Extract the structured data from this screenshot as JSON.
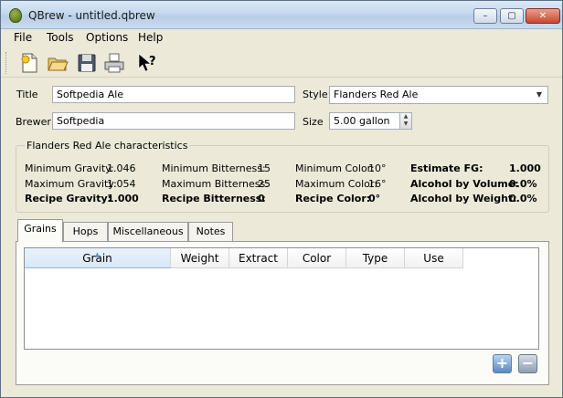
{
  "window": {
    "title": "QBrew - untitled.qbrew",
    "controls": {
      "minimize": "–",
      "maximize": "▢",
      "close": "✕"
    }
  },
  "menu": [
    "File",
    "Tools",
    "Options",
    "Help"
  ],
  "toolbar": {
    "buttons": [
      "new-document-icon",
      "open-folder-icon",
      "save-disk-icon",
      "print-icon",
      "whats-this-help-icon"
    ]
  },
  "form": {
    "title_label": "Title",
    "title_value": "Softpedia Ale",
    "style_label": "Style",
    "style_value": "Flanders Red Ale",
    "brewer_label": "Brewer",
    "brewer_value": "Softpedia",
    "size_label": "Size",
    "size_value": "5.00 gallon"
  },
  "characteristics": {
    "group_title": "Flanders Red Ale characteristics",
    "min_gravity_label": "Minimum Gravity:",
    "min_gravity": "1.046",
    "max_gravity_label": "Maximum Gravity:",
    "max_gravity": "1.054",
    "recipe_gravity_label": "Recipe Gravity:",
    "recipe_gravity": "1.000",
    "min_bitterness_label": "Minimum Bitterness:",
    "min_bitterness": "15",
    "max_bitterness_label": "Maximum Bitterness:",
    "max_bitterness": "25",
    "recipe_bitterness_label": "Recipe Bitterness:",
    "recipe_bitterness": "0",
    "min_color_label": "Minimum Color:",
    "min_color": "10°",
    "max_color_label": "Maximum Color:",
    "max_color": "16°",
    "recipe_color_label": "Recipe Color:",
    "recipe_color": "0°",
    "estimate_fg_label": "Estimate FG:",
    "estimate_fg": "1.000",
    "abv_label": "Alcohol by Volume:",
    "abv": "0.0%",
    "abw_label": "Alcohol by Weight:",
    "abw": "0.0%"
  },
  "tabs": [
    "Grains",
    "Hops",
    "Miscellaneous",
    "Notes"
  ],
  "active_tab": "Grains",
  "grain_table": {
    "columns": [
      "Grain",
      "Weight",
      "Extract",
      "Color",
      "Type",
      "Use"
    ],
    "rows": []
  },
  "actions": {
    "add": "+",
    "remove": "−"
  },
  "colors": {
    "window_bg": "#ece9d8",
    "titlebar": "#c6d8ee",
    "close_button": "#c9472d",
    "sorted_header": "#d8e8f8"
  }
}
